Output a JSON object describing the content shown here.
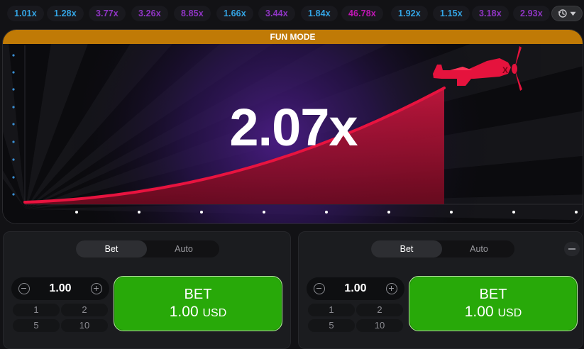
{
  "history": [
    {
      "value": "1.01x",
      "color": "blue"
    },
    {
      "value": "1.28x",
      "color": "blue"
    },
    {
      "value": "3.77x",
      "color": "purple"
    },
    {
      "value": "3.26x",
      "color": "purple"
    },
    {
      "value": "8.85x",
      "color": "purple"
    },
    {
      "value": "1.66x",
      "color": "blue"
    },
    {
      "value": "3.44x",
      "color": "purple"
    },
    {
      "value": "1.84x",
      "color": "blue"
    },
    {
      "value": "46.78x",
      "color": "pink"
    },
    {
      "value": "1.92x",
      "color": "blue"
    },
    {
      "value": "1.15x",
      "color": "blue"
    },
    {
      "value": "3.18x",
      "color": "purple"
    },
    {
      "value": "2.93x",
      "color": "purple"
    }
  ],
  "history_button_icons": [
    "history-clock-icon",
    "dropdown-caret-icon"
  ],
  "game": {
    "banner": "FUN MODE",
    "multiplier": "2.07x",
    "curve_color": "#e8133f",
    "plane_color": "#e5133d"
  },
  "colors": {
    "accent_orange": "#c07a06",
    "bet_green": "#28a909",
    "blue_multiplier": "#34a4e4",
    "purple_multiplier": "#9035c4",
    "pink_multiplier": "#c017b4"
  },
  "panels": [
    {
      "tabs": [
        "Bet",
        "Auto"
      ],
      "active_tab": "Bet",
      "amount": "1.00",
      "quick": [
        "1",
        "2",
        "5",
        "10"
      ],
      "bet_label": "BET",
      "bet_amount": "1.00",
      "currency": "USD"
    },
    {
      "tabs": [
        "Bet",
        "Auto"
      ],
      "active_tab": "Bet",
      "amount": "1.00",
      "quick": [
        "1",
        "2",
        "5",
        "10"
      ],
      "bet_label": "BET",
      "bet_amount": "1.00",
      "currency": "USD",
      "remove_icon": "minus-icon"
    }
  ]
}
